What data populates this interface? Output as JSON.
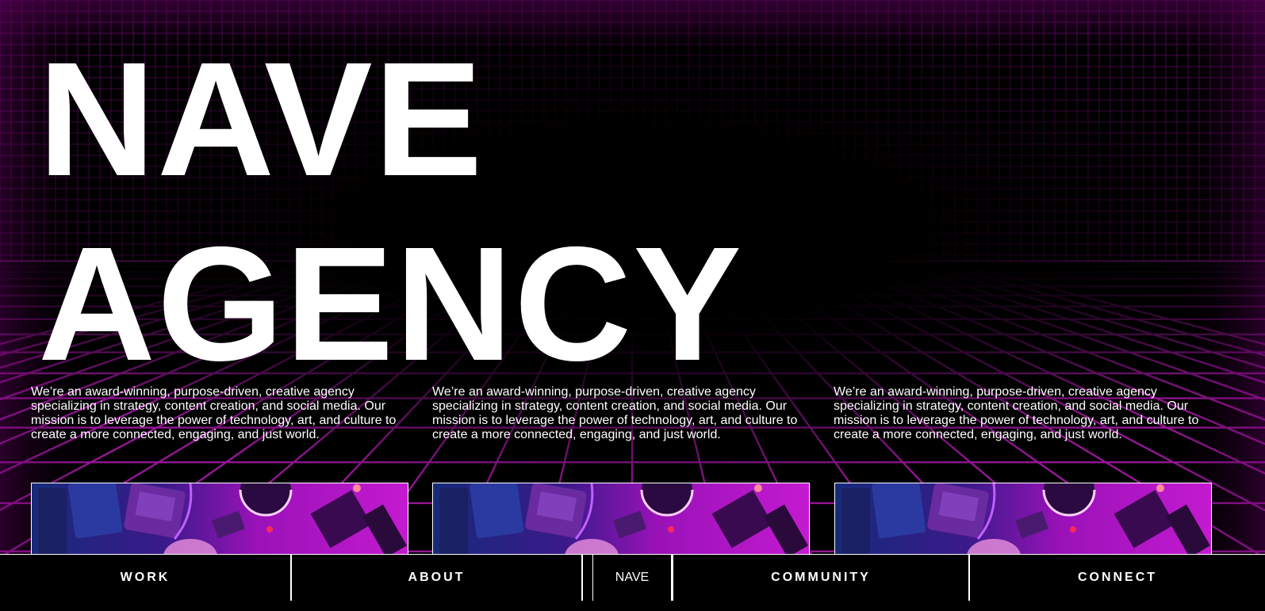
{
  "hero": {
    "line1": "NAVE",
    "line2": "AGENCY"
  },
  "columns": [
    {
      "text": "We’re an award-winning, purpose-driven, creative agency specializing in strategy, content creation, and social media. Our mission is to leverage the power of technology, art, and culture to create a more connected, engaging, and just world."
    },
    {
      "text": "We’re an award-winning, purpose-driven, creative agency specializing in strategy, content creation, and social media. Our mission is to leverage the power of technology, art, and culture to create a more connected, engaging, and just world."
    },
    {
      "text": "We’re an award-winning, purpose-driven, creative agency specializing in strategy, content creation, and social media. Our mission is to leverage the power of technology, art, and culture to create a more connected, engaging, and just world."
    }
  ],
  "nav": {
    "work": "WORK",
    "about": "ABOUT",
    "brand": "NAVE",
    "community": "COMMUNITY",
    "connect": "CONNECT"
  },
  "colors": {
    "background": "#000000",
    "grid": "#b01ab0",
    "text": "#ffffff",
    "accent_magenta": "#c000d8",
    "accent_blue": "#1a3aa8"
  }
}
